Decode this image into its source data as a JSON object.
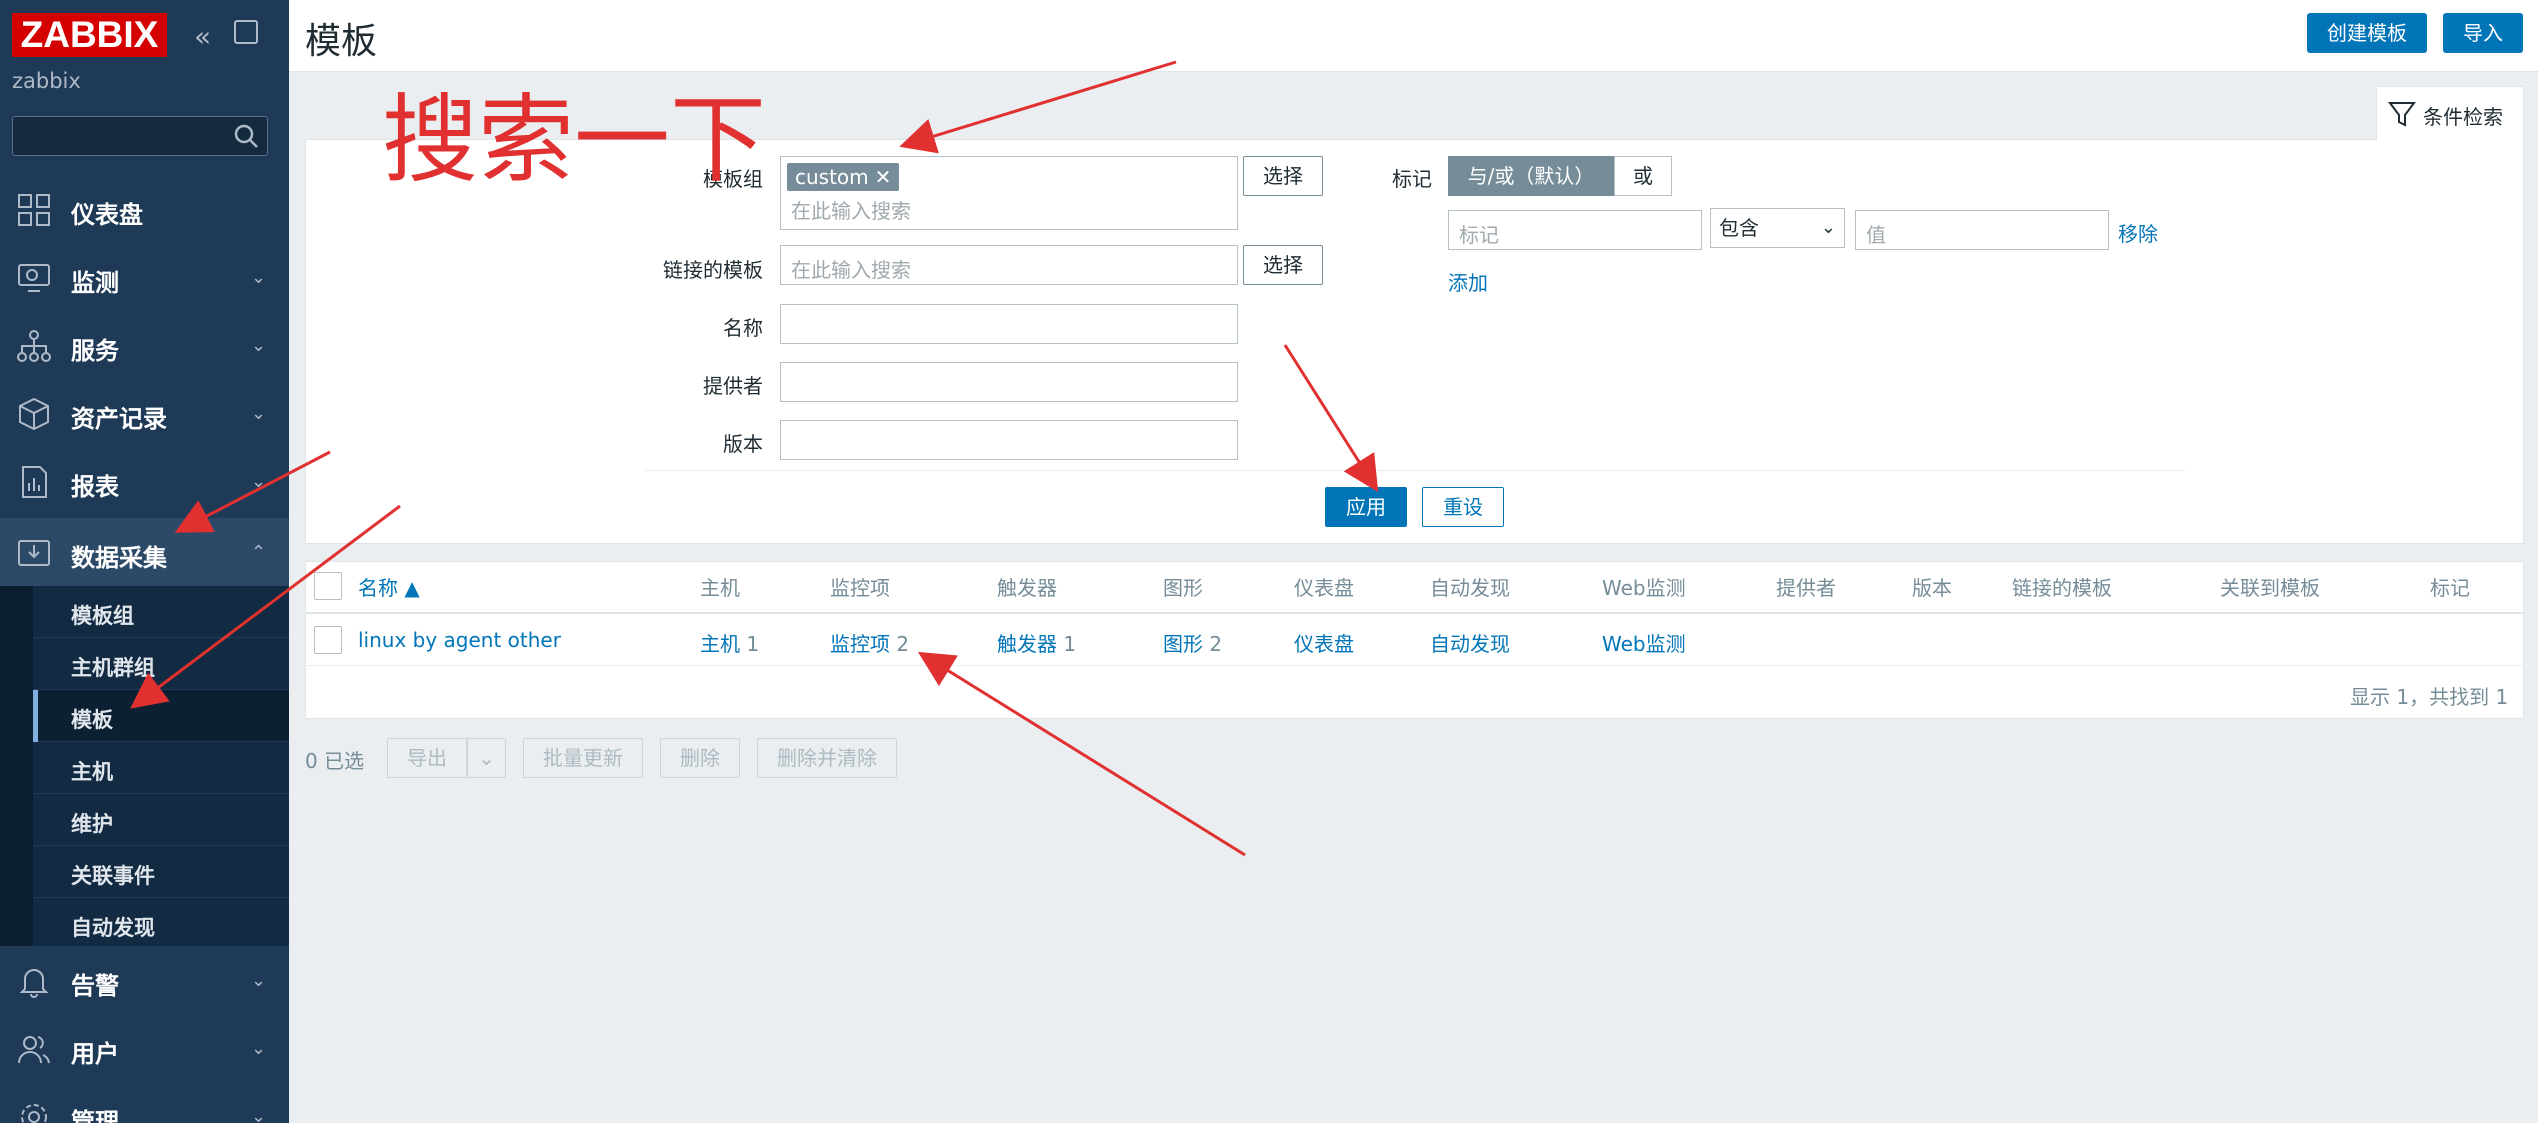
{
  "app": {
    "logo": "ZABBIX",
    "server_name": "zabbix",
    "collapse_glyph": "«",
    "accent_color": "#0275b8",
    "sidebar_color": "#1f3a56",
    "logo_color": "#d40000"
  },
  "sidebar": {
    "search_placeholder": "",
    "items": [
      {
        "label": "仪表盘",
        "icon": "dashboard-icon"
      },
      {
        "label": "监测",
        "icon": "monitoring-icon",
        "chevron": "⌄"
      },
      {
        "label": "服务",
        "icon": "services-icon",
        "chevron": "⌄"
      },
      {
        "label": "资产记录",
        "icon": "inventory-icon",
        "chevron": "⌄"
      },
      {
        "label": "报表",
        "icon": "reports-icon",
        "chevron": "⌄"
      },
      {
        "label": "数据采集",
        "icon": "data-collection-icon",
        "chevron": "⌃"
      },
      {
        "label": "告警",
        "icon": "alerts-icon",
        "chevron": "⌄"
      },
      {
        "label": "用户",
        "icon": "users-icon",
        "chevron": "⌄"
      },
      {
        "label": "管理",
        "icon": "administration-icon",
        "chevron": "⌄"
      }
    ],
    "subitems": [
      "模板组",
      "主机群组",
      "模板",
      "主机",
      "维护",
      "关联事件",
      "自动发现"
    ]
  },
  "header": {
    "title": "模板",
    "help": "?",
    "create_label": "创建模板",
    "import_label": "导入"
  },
  "filter": {
    "tab_label": "条件检索",
    "template_group_label": "模板组",
    "chip": "custom",
    "chip_remove": "✕",
    "search_placeholder": "在此输入搜索",
    "select_label": "选择",
    "linked_label": "链接的模板",
    "name_label": "名称",
    "vendor_label": "提供者",
    "version_label": "版本",
    "tags_label": "标记",
    "andor_label": "与/或（默认）",
    "or_label": "或",
    "tag_placeholder": "标记",
    "operator": "包含",
    "operator_caret": "⌄",
    "value_placeholder": "值",
    "remove_label": "移除",
    "add_label": "添加",
    "apply_label": "应用",
    "reset_label": "重设"
  },
  "table": {
    "columns": [
      "名称 ▲",
      "主机",
      "监控项",
      "触发器",
      "图形",
      "仪表盘",
      "自动发现",
      "Web监测",
      "提供者",
      "版本",
      "链接的模板",
      "关联到模板",
      "标记"
    ],
    "rows": [
      {
        "name": "linux by agent other",
        "hosts": "主机",
        "hosts_count": "1",
        "items": "监控项",
        "items_count": "2",
        "triggers": "触发器",
        "triggers_count": "1",
        "graphs": "图形",
        "graphs_count": "2",
        "dashboards": "仪表盘",
        "discovery": "自动发现",
        "web": "Web监测"
      }
    ],
    "summary": "显示 1，共找到 1"
  },
  "actions": {
    "selected": "0 已选",
    "export": "导出",
    "export_caret": "⌄",
    "mass_update": "批量更新",
    "delete": "删除",
    "delete_clear": "删除并清除"
  },
  "annotation": {
    "text": "搜索一下",
    "color": "#e03030"
  }
}
